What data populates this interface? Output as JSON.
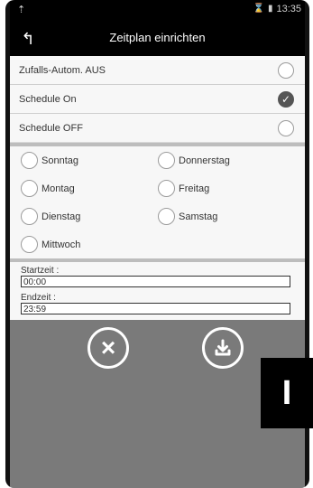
{
  "statusbar": {
    "time": "13:35"
  },
  "header": {
    "title": "Zeitplan einrichten"
  },
  "modes": [
    {
      "label": "Zufalls-Autom. AUS",
      "selected": false
    },
    {
      "label": "Schedule On",
      "selected": true
    },
    {
      "label": "Schedule OFF",
      "selected": false
    }
  ],
  "days": {
    "sunday": "Sonntag",
    "monday": "Montag",
    "tuesday": "Dienstag",
    "wednesday": "Mittwoch",
    "thursday": "Donnerstag",
    "friday": "Freitag",
    "saturday": "Samstag"
  },
  "times": {
    "start_label": "Startzeit :",
    "start_value": "00:00",
    "end_label": "Endzeit :",
    "end_value": "23:59"
  },
  "side_tab": {
    "label": "I"
  },
  "icons": {
    "back": "back-arrow-icon",
    "cancel": "close-icon",
    "save": "download-icon",
    "check": "check-icon"
  }
}
